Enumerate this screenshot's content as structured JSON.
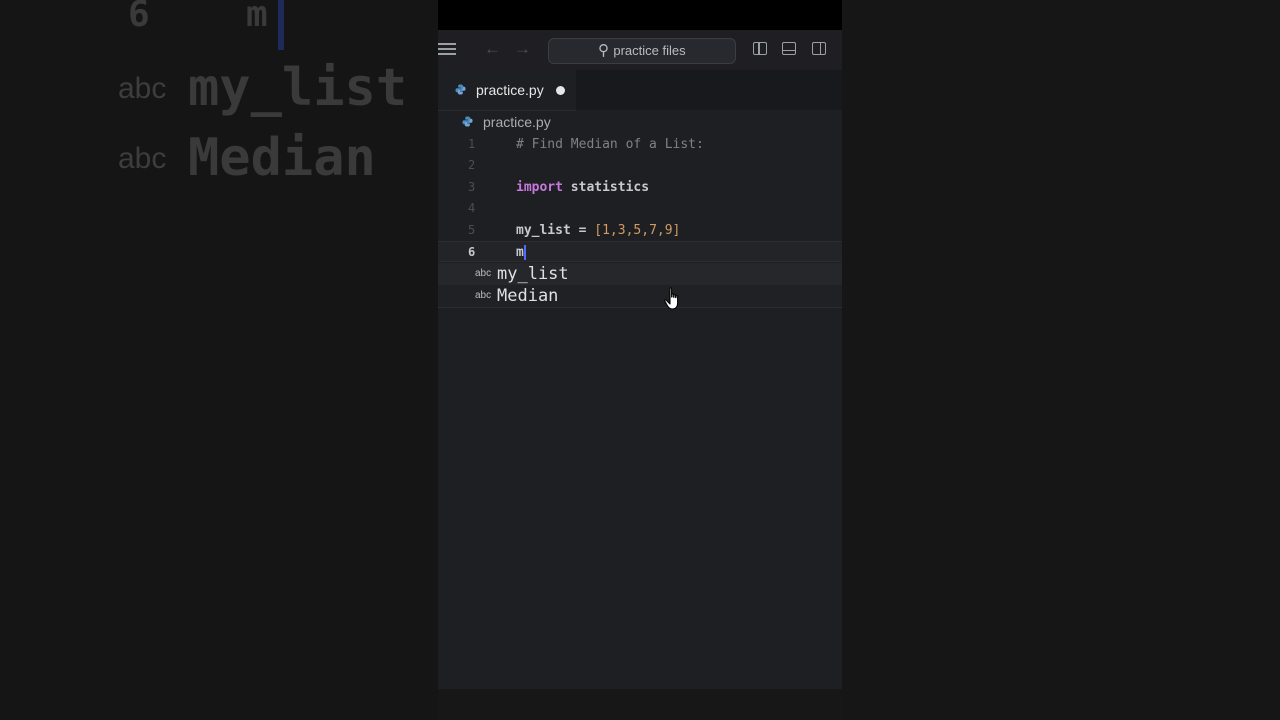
{
  "background": {
    "line_number": "6",
    "typed": "m",
    "suggestions": [
      {
        "kind": "abc",
        "label": "my_list"
      },
      {
        "kind": "abc",
        "label": "Median"
      }
    ]
  },
  "titlebar": {
    "search_placeholder": "practice files",
    "icons": [
      "menu-icon",
      "back-arrow-icon",
      "forward-arrow-icon",
      "search-icon",
      "toggle-primary-sidebar-icon",
      "toggle-panel-icon",
      "toggle-secondary-sidebar-icon"
    ]
  },
  "tabs": [
    {
      "label": "practice.py",
      "modified": true
    }
  ],
  "breadcrumb": {
    "file": "practice.py"
  },
  "editor": {
    "lines": [
      {
        "n": "1",
        "text": "# Find Median of a List:"
      },
      {
        "n": "2",
        "text": ""
      },
      {
        "n": "3",
        "kw": "import",
        "rest": " statistics"
      },
      {
        "n": "4",
        "text": ""
      },
      {
        "n": "5",
        "name": "my_list = ",
        "list": "[1,3,5,7,9]"
      },
      {
        "n": "6",
        "text": "m"
      }
    ],
    "current_line": 6
  },
  "suggest": {
    "items": [
      {
        "kind": "abc",
        "label": "my_list"
      },
      {
        "kind": "abc",
        "label": "Median"
      }
    ]
  },
  "colors": {
    "keyword": "#c678dd",
    "number": "#d19a66",
    "comment": "#7e8188",
    "caret": "#4d6bff"
  }
}
